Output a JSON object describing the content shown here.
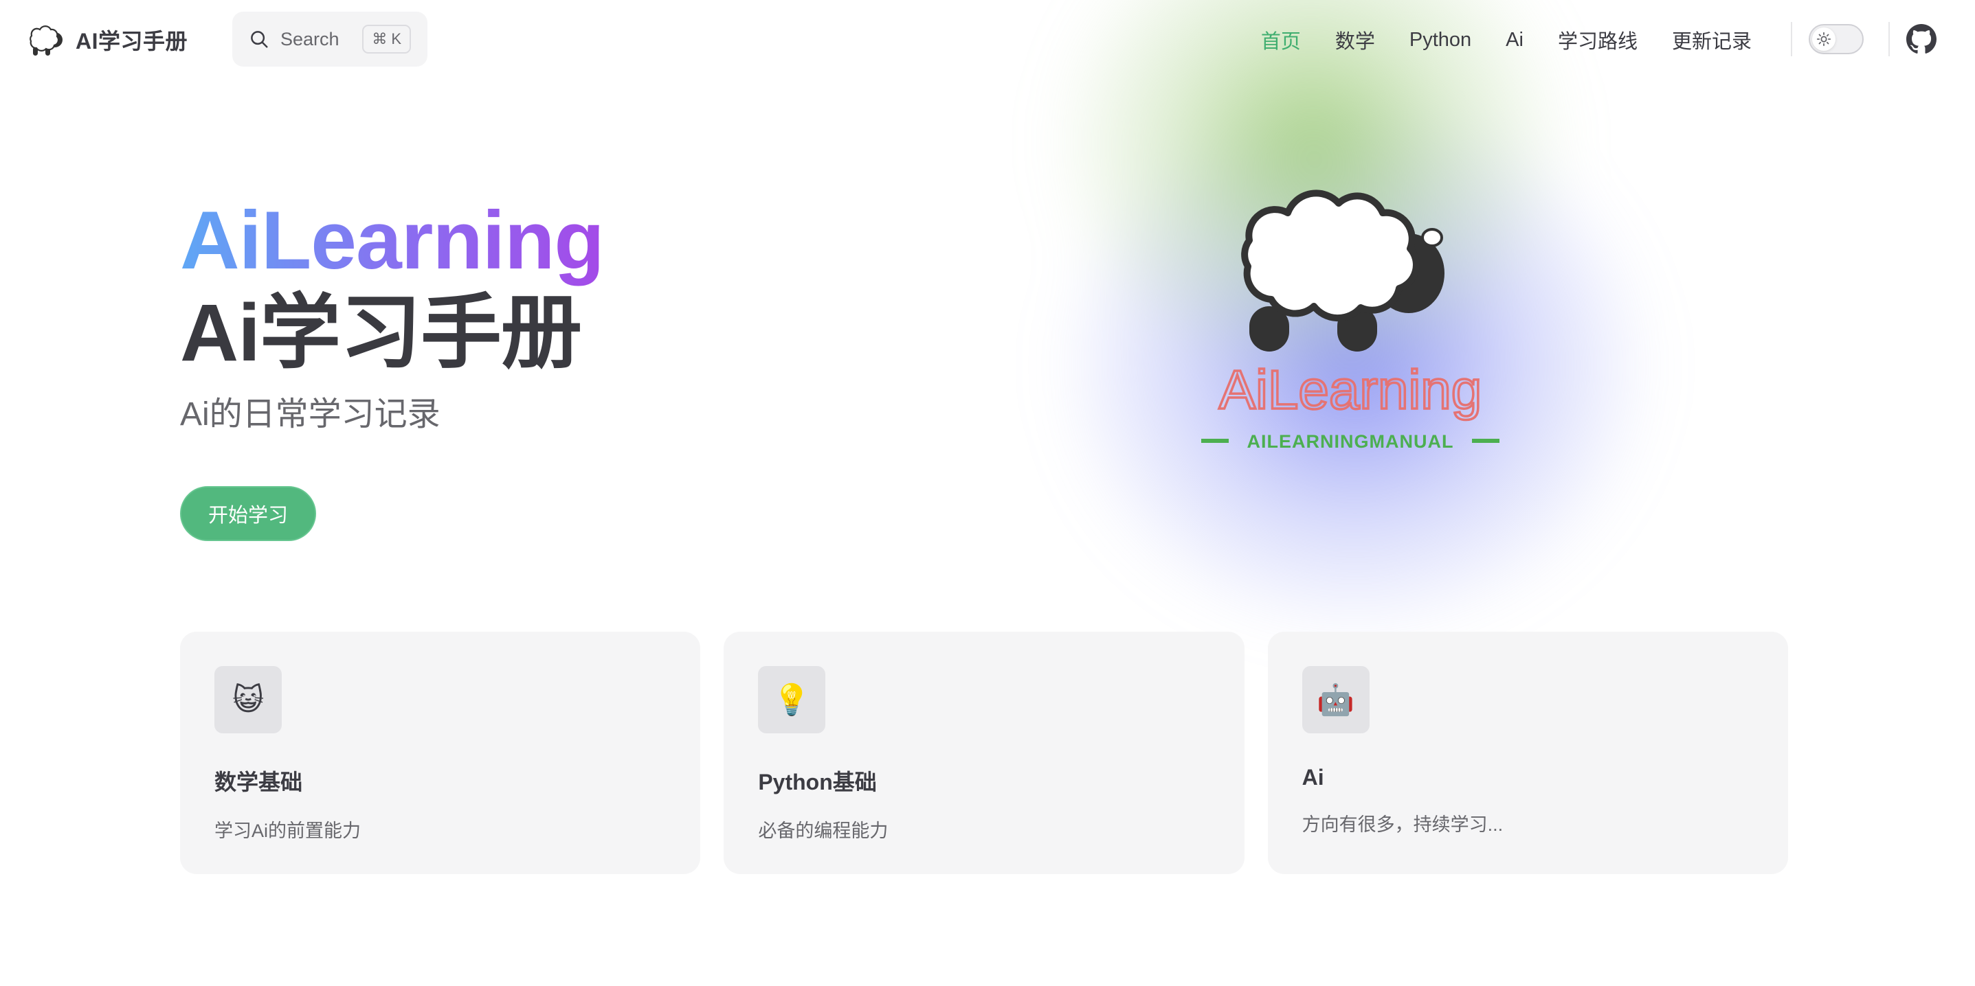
{
  "brand": {
    "name": "AI学习手册"
  },
  "search": {
    "label": "Search",
    "kbd_symbol": "⌘",
    "kbd_key": "K"
  },
  "nav": {
    "links": [
      {
        "label": "首页",
        "active": true
      },
      {
        "label": "数学",
        "active": false
      },
      {
        "label": "Python",
        "active": false
      },
      {
        "label": "Ai",
        "active": false
      },
      {
        "label": "学习路线",
        "active": false
      },
      {
        "label": "更新记录",
        "active": false
      }
    ]
  },
  "hero": {
    "name": "AiLearning",
    "title": "Ai学习手册",
    "tagline": "Ai的日常学习记录",
    "action": "开始学习",
    "image_text": "AiLearning",
    "image_subtext": "AILEARNINGMANUAL"
  },
  "features": [
    {
      "icon": "😺",
      "icon_name": "cat-face-icon",
      "title": "数学基础",
      "details": "学习Ai的前置能力"
    },
    {
      "icon": "💡",
      "icon_name": "light-bulb-icon",
      "title": "Python基础",
      "details": "必备的编程能力"
    },
    {
      "icon": "🤖",
      "icon_name": "robot-icon",
      "title": "Ai",
      "details": "方向有很多，持续学习..."
    }
  ],
  "colors": {
    "brand_green": "#52b87e",
    "active_nav": "#3fae6f",
    "name_gradient_start": "#5fa7f5",
    "name_gradient_end": "#a44ae8",
    "logo_text": "#e57373",
    "logo_subtext": "#4caf50"
  }
}
